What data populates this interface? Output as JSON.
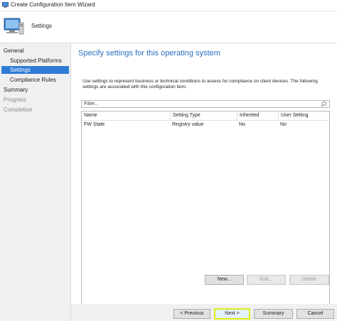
{
  "window": {
    "title": "Create Configuration Item Wizard"
  },
  "header": {
    "title": "Settings"
  },
  "nav": {
    "items": [
      {
        "label": "General"
      },
      {
        "label": "Supported Platforms"
      },
      {
        "label": "Settings"
      },
      {
        "label": "Compliance Rules"
      },
      {
        "label": "Summary"
      },
      {
        "label": "Progress"
      },
      {
        "label": "Completion"
      }
    ]
  },
  "main": {
    "title": "Specify settings for this operating system",
    "description": "Use settings to represent business or technical conditions to assess for compliance on client devices. The following settings are associated with this configuration item.",
    "filter_placeholder": "Filter...",
    "columns": [
      "Name",
      "Setting Type",
      "Inherited",
      "User Setting"
    ],
    "rows": [
      [
        "FW State",
        "Registry value",
        "No",
        "No"
      ]
    ],
    "buttons": {
      "new": "New...",
      "edit": "Edit...",
      "delete": "Delete"
    }
  },
  "footer": {
    "previous": "< Previous",
    "next": "Next >",
    "summary": "Summary",
    "cancel": "Cancel"
  },
  "colors": {
    "accent": "#2f7bd6",
    "title_blue": "#2a6ebf",
    "highlight": "#e4f21a"
  }
}
